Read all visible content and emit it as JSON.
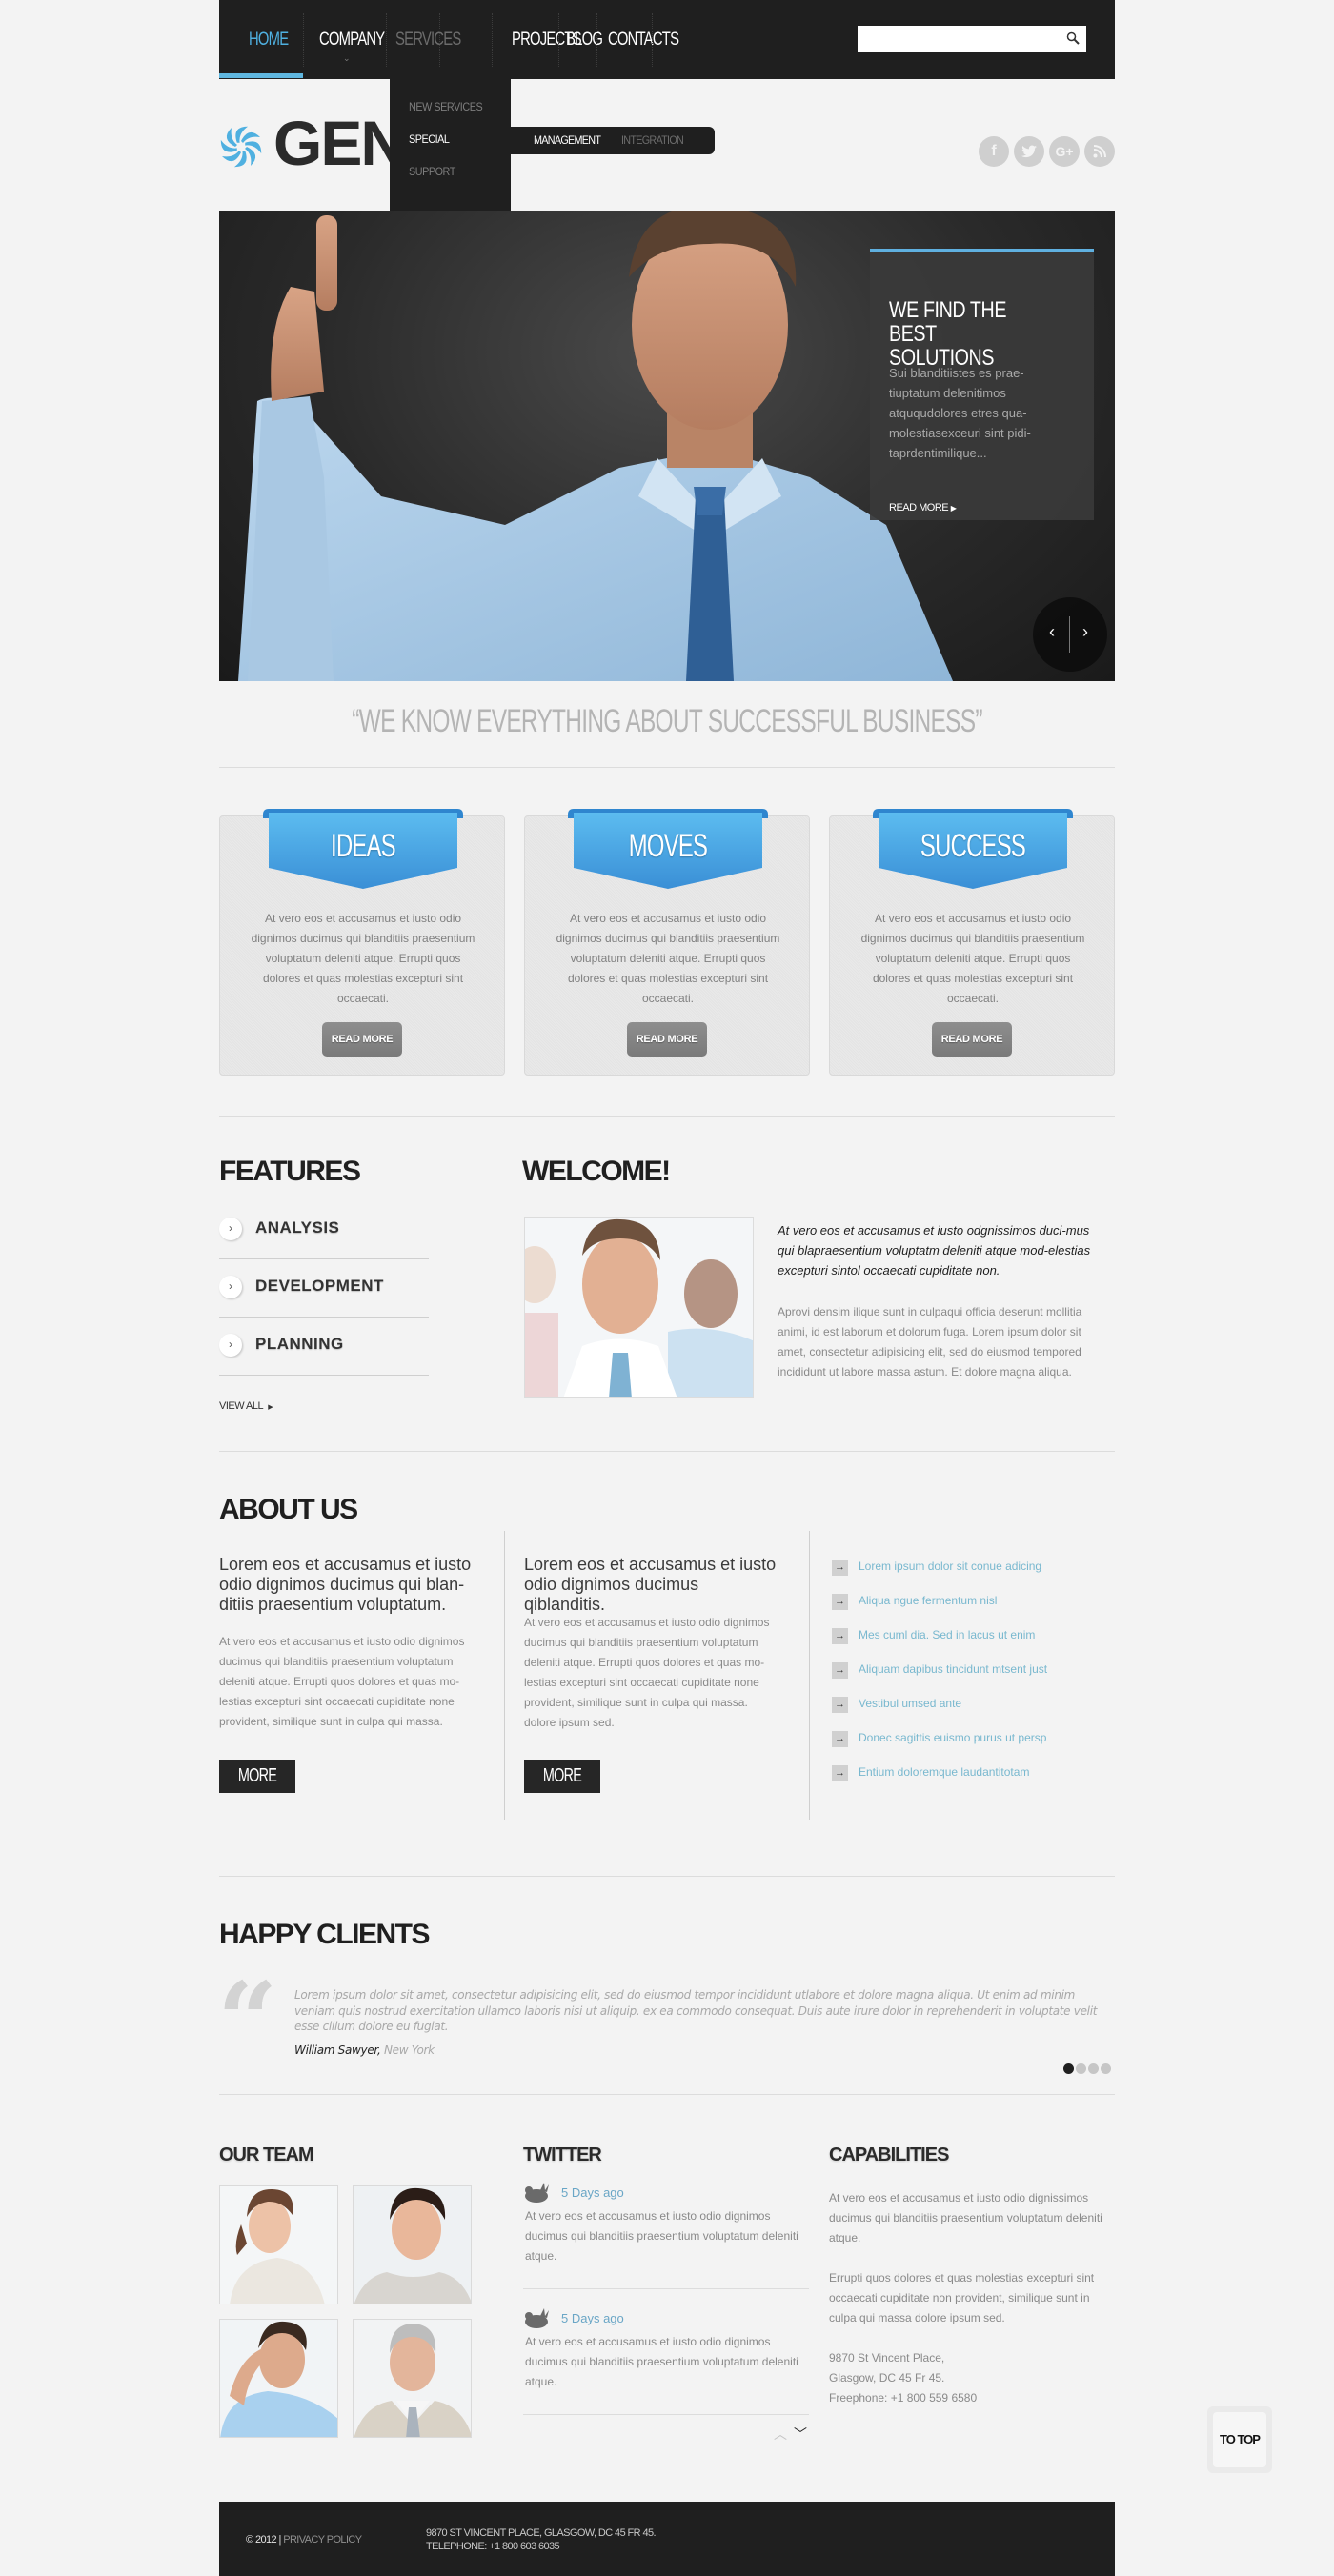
{
  "nav": {
    "items": [
      {
        "label": "HOME",
        "state": "active"
      },
      {
        "label": "COMPANY",
        "state": "normal"
      },
      {
        "label": "SERVICES",
        "state": "open"
      },
      {
        "label": "PROJECTS",
        "state": "normal"
      },
      {
        "label": "BLOG",
        "state": "normal"
      },
      {
        "label": "CONTACTS",
        "state": "normal"
      }
    ],
    "search": {
      "value": "",
      "placeholder": "",
      "icon": "search-icon"
    },
    "services_dropdown": [
      {
        "label": "NEW SERVICES",
        "state": "normal"
      },
      {
        "label": "SPECIAL",
        "state": "hover"
      },
      {
        "label": "SUPPORT",
        "state": "normal"
      }
    ],
    "services_submenu": [
      {
        "label": "MANAGEMENT",
        "state": "active"
      },
      {
        "label": "INTEGRATION",
        "state": "normal"
      }
    ]
  },
  "logo": {
    "text": "GENERAL",
    "visible_text": "GEN",
    "icon": "pinwheel-icon"
  },
  "social": [
    {
      "name": "facebook",
      "glyph": "f"
    },
    {
      "name": "twitter",
      "glyph": "t"
    },
    {
      "name": "google-plus",
      "glyph": "G+"
    },
    {
      "name": "rss",
      "glyph": "rss"
    }
  ],
  "hero": {
    "card_title_line1": "WE FIND THE",
    "card_title_line2": "BEST SOLUTIONS",
    "card_text": "Sui blanditiistes es prae-tiuptatum delenitimos atququdolores etres qua-molestiasexceuri sint pidi-taprdentimilique...",
    "read_more": "READ MORE",
    "prev": "‹",
    "next": "›"
  },
  "slogan": "“WE KNOW EVERYTHING ABOUT SUCCESSFUL BUSINESS”",
  "boxes": [
    {
      "title": "IDEAS",
      "text": "At vero eos et accusamus et iusto odio dignimos ducimus qui blanditiis praesentium voluptatum deleniti atque. Errupti quos dolores et quas molestias excepturi sint occaecati.",
      "button": "READ MORE"
    },
    {
      "title": "MOVES",
      "text": "At vero eos et accusamus et iusto odio dignimos ducimus qui blanditiis praesentium voluptatum deleniti atque. Errupti quos dolores et quas molestias excepturi sint occaecati.",
      "button": "READ MORE"
    },
    {
      "title": "SUCCESS",
      "text": "At vero eos et accusamus et iusto odio dignimos ducimus qui blanditiis praesentium voluptatum deleniti atque. Errupti quos dolores et quas molestias excepturi sint occaecati.",
      "button": "READ MORE"
    }
  ],
  "features": {
    "title": "FEATURES",
    "items": [
      "ANALYSIS",
      "DEVELOPMENT",
      "PLANNING"
    ],
    "view_all": "VIEW ALL"
  },
  "welcome": {
    "title": "WELCOME!",
    "lead": "At vero eos et accusamus et iusto odgnissimos duci-mus qui blapraesentium voluptatm deleniti atque mod-elestias excepturi sintol occaecati cupiditate non.",
    "text": "Aprovi densim ilique sunt in culpaqui officia deserunt mollitia animi, id est laborum et dolorum fuga. Lorem ipsum dolor sit amet, consectetur adipisicing elit, sed do eiusmod tempored incididunt ut labore massa astum. Et dolore magna aliqua."
  },
  "about": {
    "title": "ABOUT US",
    "columns": [
      {
        "lead": "Lorem eos et accusamus et iusto odio dignimos ducimus qui blan-ditiis praesentium voluptatum.",
        "text": "At vero eos et accusamus et iusto odio dignimos ducimus qui blanditiis praesentium voluptatum deleniti atque. Errupti quos dolores et quas mo-lestias excepturi sint occaecati cupiditate none provident, similique sunt in culpa qui massa.",
        "button": "MORE"
      },
      {
        "lead": "Lorem eos et accusamus et iusto odio dignimos ducimus qiblanditis.",
        "text": "At vero eos et accusamus et iusto odio dignimos ducimus qui blanditiis praesentium voluptatum deleniti atque. Errupti quos dolores et quas mo-lestias excepturi sint occaecati cupiditate none provident, similique sunt in culpa qui massa. dolore ipsum sed.",
        "button": "MORE"
      }
    ],
    "links": [
      "Lorem ipsum dolor sit conue adicing",
      "Aliqua ngue fermentum nisl",
      "Mes cuml dia. Sed in lacus ut enim",
      "Aliquam dapibus tincidunt mtsent just",
      "Vestibul umsed ante",
      "Donec sagittis euismo purus ut persp",
      "Entium doloremque laudantitotam"
    ]
  },
  "clients": {
    "title": "HAPPY CLIENTS",
    "quote": "Lorem ipsum dolor sit amet, consectetur adipisicing elit, sed do eiusmod tempor incididunt utlabore et dolore magna aliqua. Ut enim ad minim veniam quis nostrud exercitation ullamco laboris nisi ut aliquip. ex ea commodo consequat. Duis aute irure dolor in reprehenderit in voluptate velit esse cillum dolore eu fugiat.",
    "author": "William Sawyer,",
    "city": "New York",
    "pager": {
      "count": 4,
      "active": 1
    }
  },
  "team": {
    "title": "OUR TEAM",
    "members": [
      "team-member-1",
      "team-member-2",
      "team-member-3",
      "team-member-4"
    ]
  },
  "twitter": {
    "title": "TWITTER",
    "tweets": [
      {
        "date": "5 Days ago",
        "text": "At vero eos et accusamus et iusto odio dignimos ducimus qui blanditiis praesentium voluptatum deleniti atque."
      },
      {
        "date": "5 Days ago",
        "text": "At vero eos et accusamus et iusto odio dignimos ducimus qui blanditiis praesentium voluptatum deleniti atque."
      }
    ],
    "up": "︿",
    "down": "﹀"
  },
  "capabilities": {
    "title": "CAPABILITIES",
    "p1": "At vero eos et accusamus et iusto odio dignissimos ducimus qui blanditiis praesentium voluptatum deleniti atque.",
    "p2": "Errupti quos dolores et quas molestias excepturi sint occaecati cupiditate non provident, similique sunt in culpa qui massa dolore ipsum sed.",
    "addr1": "9870 St Vincent Place,",
    "addr2": "Glasgow, DC 45 Fr 45.",
    "phone": "Freephone:  +1 800 559 6580"
  },
  "to_top": "TO TOP",
  "footer": {
    "copyright": "© 2012 | ",
    "privacy": "PRIVACY POLICY",
    "address": "9870 ST VINCENT PLACE, GLASGOW, DC 45 FR 45.",
    "telephone": "TELEPHONE:  +1 800 603 6035"
  },
  "colors": {
    "accent": "#5fb0e0",
    "nav_bg": "#1f1f1f",
    "page_bg": "#f3f3f3",
    "link": "#79b8cf"
  }
}
